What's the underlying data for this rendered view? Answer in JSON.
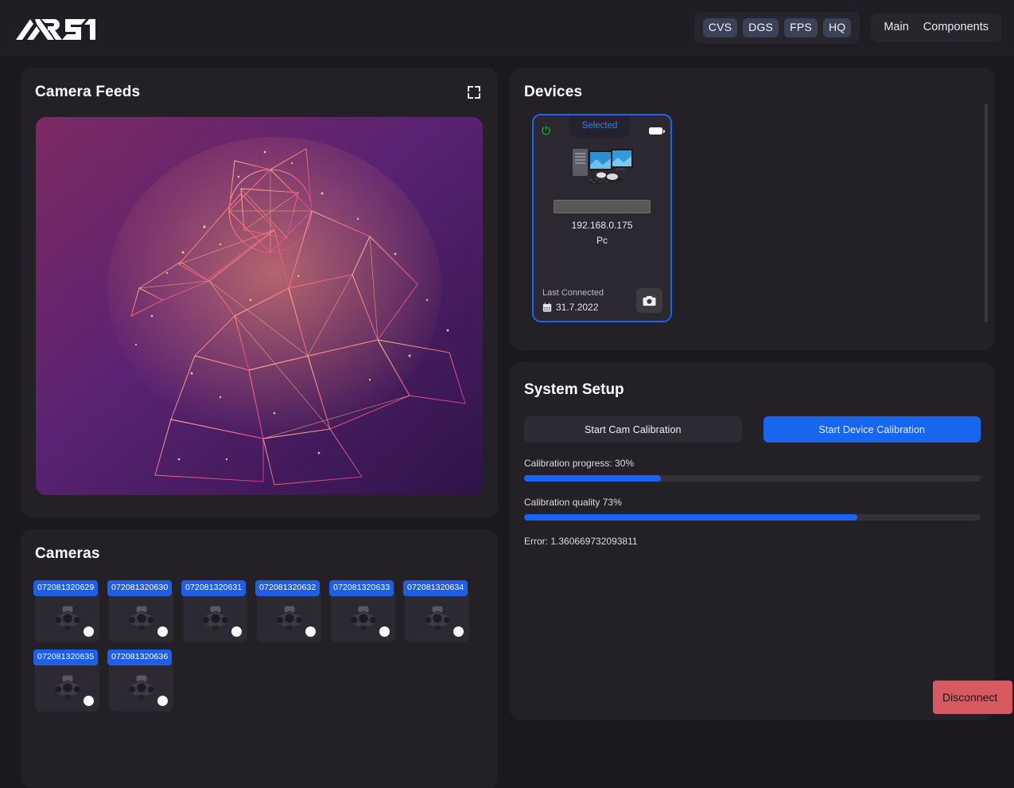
{
  "app": {
    "logo_text": "AR 51"
  },
  "topbar": {
    "badges": [
      "CVS",
      "DGS",
      "FPS",
      "HQ"
    ],
    "nav_links": [
      "Main",
      "Components"
    ]
  },
  "camera_feeds": {
    "title": "Camera Feeds",
    "expand_icon": "fullscreen-icon"
  },
  "cameras": {
    "title": "Cameras",
    "items": [
      {
        "id": "072081320629",
        "status": "active"
      },
      {
        "id": "072081320630",
        "status": "active"
      },
      {
        "id": "072081320631",
        "status": "active"
      },
      {
        "id": "072081320632",
        "status": "active"
      },
      {
        "id": "072081320633",
        "status": "active"
      },
      {
        "id": "072081320634",
        "status": "active"
      },
      {
        "id": "072081320635",
        "status": "active"
      },
      {
        "id": "072081320636",
        "status": "active"
      }
    ]
  },
  "devices": {
    "title": "Devices",
    "cards": [
      {
        "power_icon": "power-icon",
        "status_label": "Selected",
        "battery_icon": "battery-icon",
        "device_image": "pc-image",
        "ip": "192.168.0.175",
        "type": "Pc",
        "last_connected_label": "Last Connected",
        "last_connected_date": "31.7.2022",
        "calendar_icon": "calendar-icon",
        "action_icon": "camera-icon"
      }
    ]
  },
  "system_setup": {
    "title": "System Setup",
    "cam_calibration_button": "Start Cam Calibration",
    "device_calibration_button": "Start Device Calibration",
    "progress_label": "Calibration progress: 30%",
    "progress_value": 30,
    "quality_label": "Calibration quality 73%",
    "quality_value": 73,
    "error_label": "Error: 1.360669732093811"
  },
  "footer": {
    "disconnect_label": "Disconnect"
  },
  "colors": {
    "accent_blue": "#1766f0",
    "page_bg": "#1b191f",
    "panel_bg": "#232026",
    "danger": "#d65a60",
    "power_green": "#19c52f"
  }
}
